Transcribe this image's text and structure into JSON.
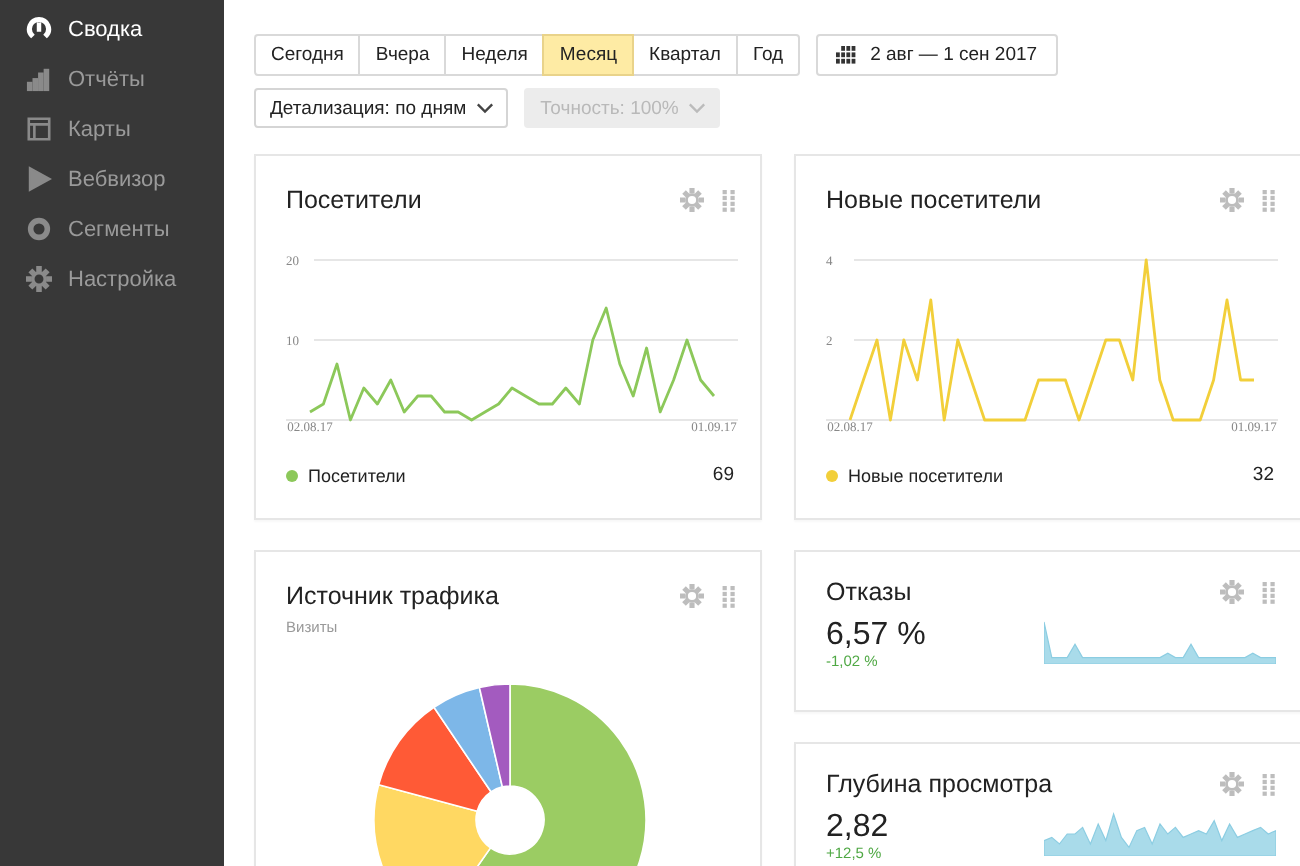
{
  "sidebar": {
    "items": [
      {
        "label": "Сводка",
        "selected": true
      },
      {
        "label": "Отчёты",
        "selected": false
      },
      {
        "label": "Карты",
        "selected": false
      },
      {
        "label": "Вебвизор",
        "selected": false
      },
      {
        "label": "Сегменты",
        "selected": false
      },
      {
        "label": "Настройка",
        "selected": false
      }
    ]
  },
  "periods": [
    {
      "label": "Сегодня",
      "selected": false
    },
    {
      "label": "Вчера",
      "selected": false
    },
    {
      "label": "Неделя",
      "selected": false
    },
    {
      "label": "Месяц",
      "selected": true
    },
    {
      "label": "Квартал",
      "selected": false
    },
    {
      "label": "Год",
      "selected": false
    }
  ],
  "date_range": {
    "label": "2 авг — 1 сен 2017"
  },
  "detail_dropdown": {
    "label": "Детализация: по дням",
    "disabled": false
  },
  "accuracy_dropdown": {
    "label": "Точность: 100%",
    "disabled": true
  },
  "widgets": [
    {
      "kind": "line",
      "title": "Посетители",
      "total": "69",
      "chart_data": {
        "type": "line",
        "categories": [
          "02.08.17",
          null,
          null,
          null,
          null,
          null,
          null,
          null,
          null,
          null,
          null,
          null,
          null,
          null,
          null,
          null,
          null,
          null,
          null,
          null,
          null,
          null,
          null,
          null,
          null,
          null,
          null,
          null,
          null,
          null,
          "01.09.17"
        ],
        "yticks": [
          10,
          20
        ],
        "ylim": [
          0,
          20
        ],
        "series": [
          {
            "name": "Посетители",
            "color": "#8cc85a",
            "values": [
              1,
              2,
              7,
              0,
              4,
              2,
              5,
              1,
              3,
              3,
              1,
              1,
              0,
              1,
              2,
              4,
              3,
              2,
              2,
              4,
              2,
              10,
              14,
              7,
              3,
              9,
              1,
              5,
              10,
              5,
              3
            ]
          }
        ]
      }
    },
    {
      "kind": "line",
      "title": "Новые посетители",
      "total": "32",
      "chart_data": {
        "type": "line",
        "categories": [
          "02.08.17",
          null,
          null,
          null,
          null,
          null,
          null,
          null,
          null,
          null,
          null,
          null,
          null,
          null,
          null,
          null,
          null,
          null,
          null,
          null,
          null,
          null,
          null,
          null,
          null,
          null,
          null,
          null,
          null,
          null,
          "01.09.17"
        ],
        "yticks": [
          2,
          4
        ],
        "ylim": [
          0,
          4
        ],
        "series": [
          {
            "name": "Новые посетители",
            "color": "#f2cf3a",
            "values": [
              0,
              1,
              2,
              0,
              2,
              1,
              3,
              0,
              2,
              1,
              0,
              0,
              0,
              0,
              1,
              1,
              1,
              0,
              1,
              2,
              2,
              1,
              4,
              1,
              0,
              0,
              0,
              1,
              3,
              1,
              1
            ]
          }
        ]
      }
    },
    {
      "kind": "pie",
      "title": "Источник трафика",
      "subtitle": "Визиты"
    },
    {
      "kind": "metric",
      "title": "Отказы",
      "value": "6,57 %",
      "change": "-1,02 %"
    },
    {
      "kind": "metric",
      "title": "Глубина просмотра",
      "value": "2,82",
      "change": "+12,5 %"
    }
  ]
}
